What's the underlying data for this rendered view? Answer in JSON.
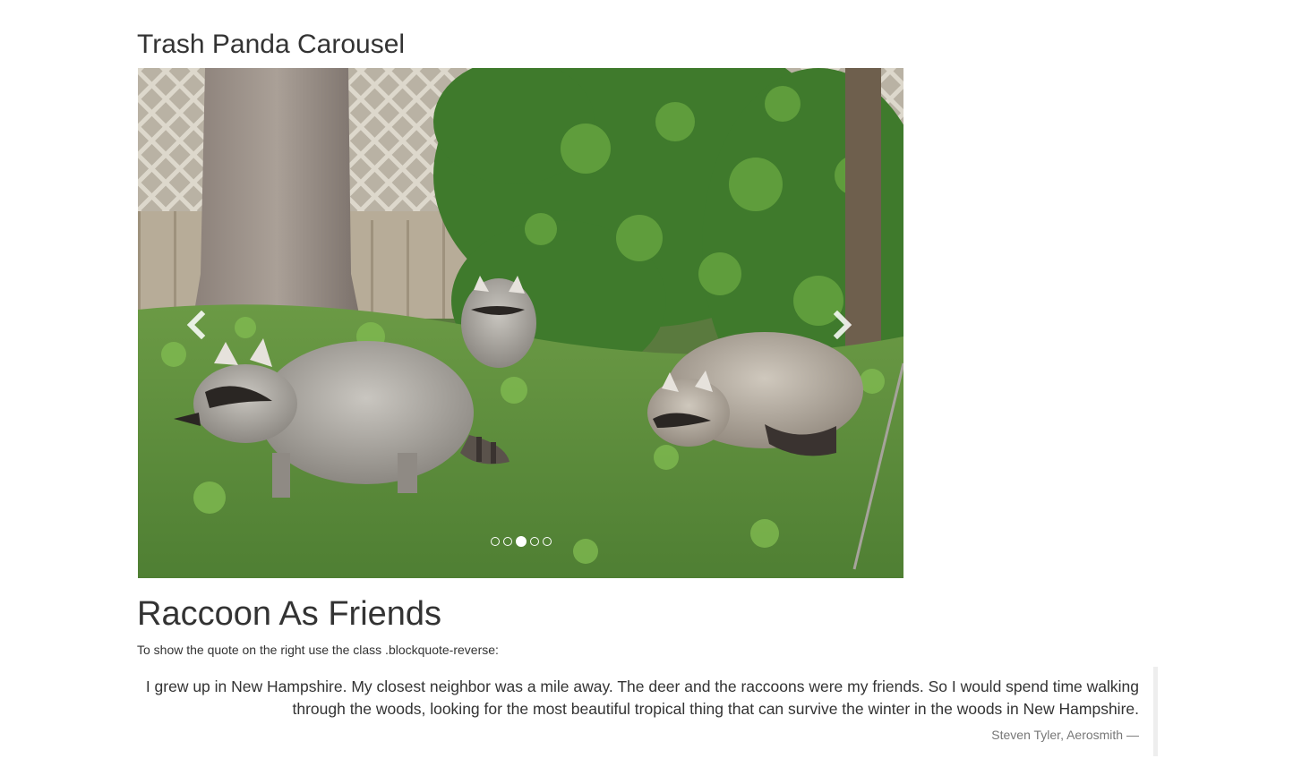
{
  "page": {
    "title": "Trash Panda Carousel"
  },
  "carousel": {
    "image_description_icon": "raccoons-photo",
    "prev_icon": "chevron-left-icon",
    "next_icon": "chevron-right-icon",
    "slide_count": 5,
    "active_slide": 3
  },
  "section": {
    "heading": "Raccoon As Friends",
    "hint": "To show the quote on the right use the class .blockquote-reverse:"
  },
  "quote": {
    "text": "I grew up in New Hampshire. My closest neighbor was a mile away. The deer and the raccoons were my friends. So I would spend time walking through the woods, looking for the most beautiful tropical thing that can survive the winter in the woods in New Hampshire.",
    "source": "Steven Tyler, Aerosmith —"
  },
  "colors": {
    "text": "#333333",
    "muted": "#777777",
    "quote_border": "#eeeeee"
  }
}
